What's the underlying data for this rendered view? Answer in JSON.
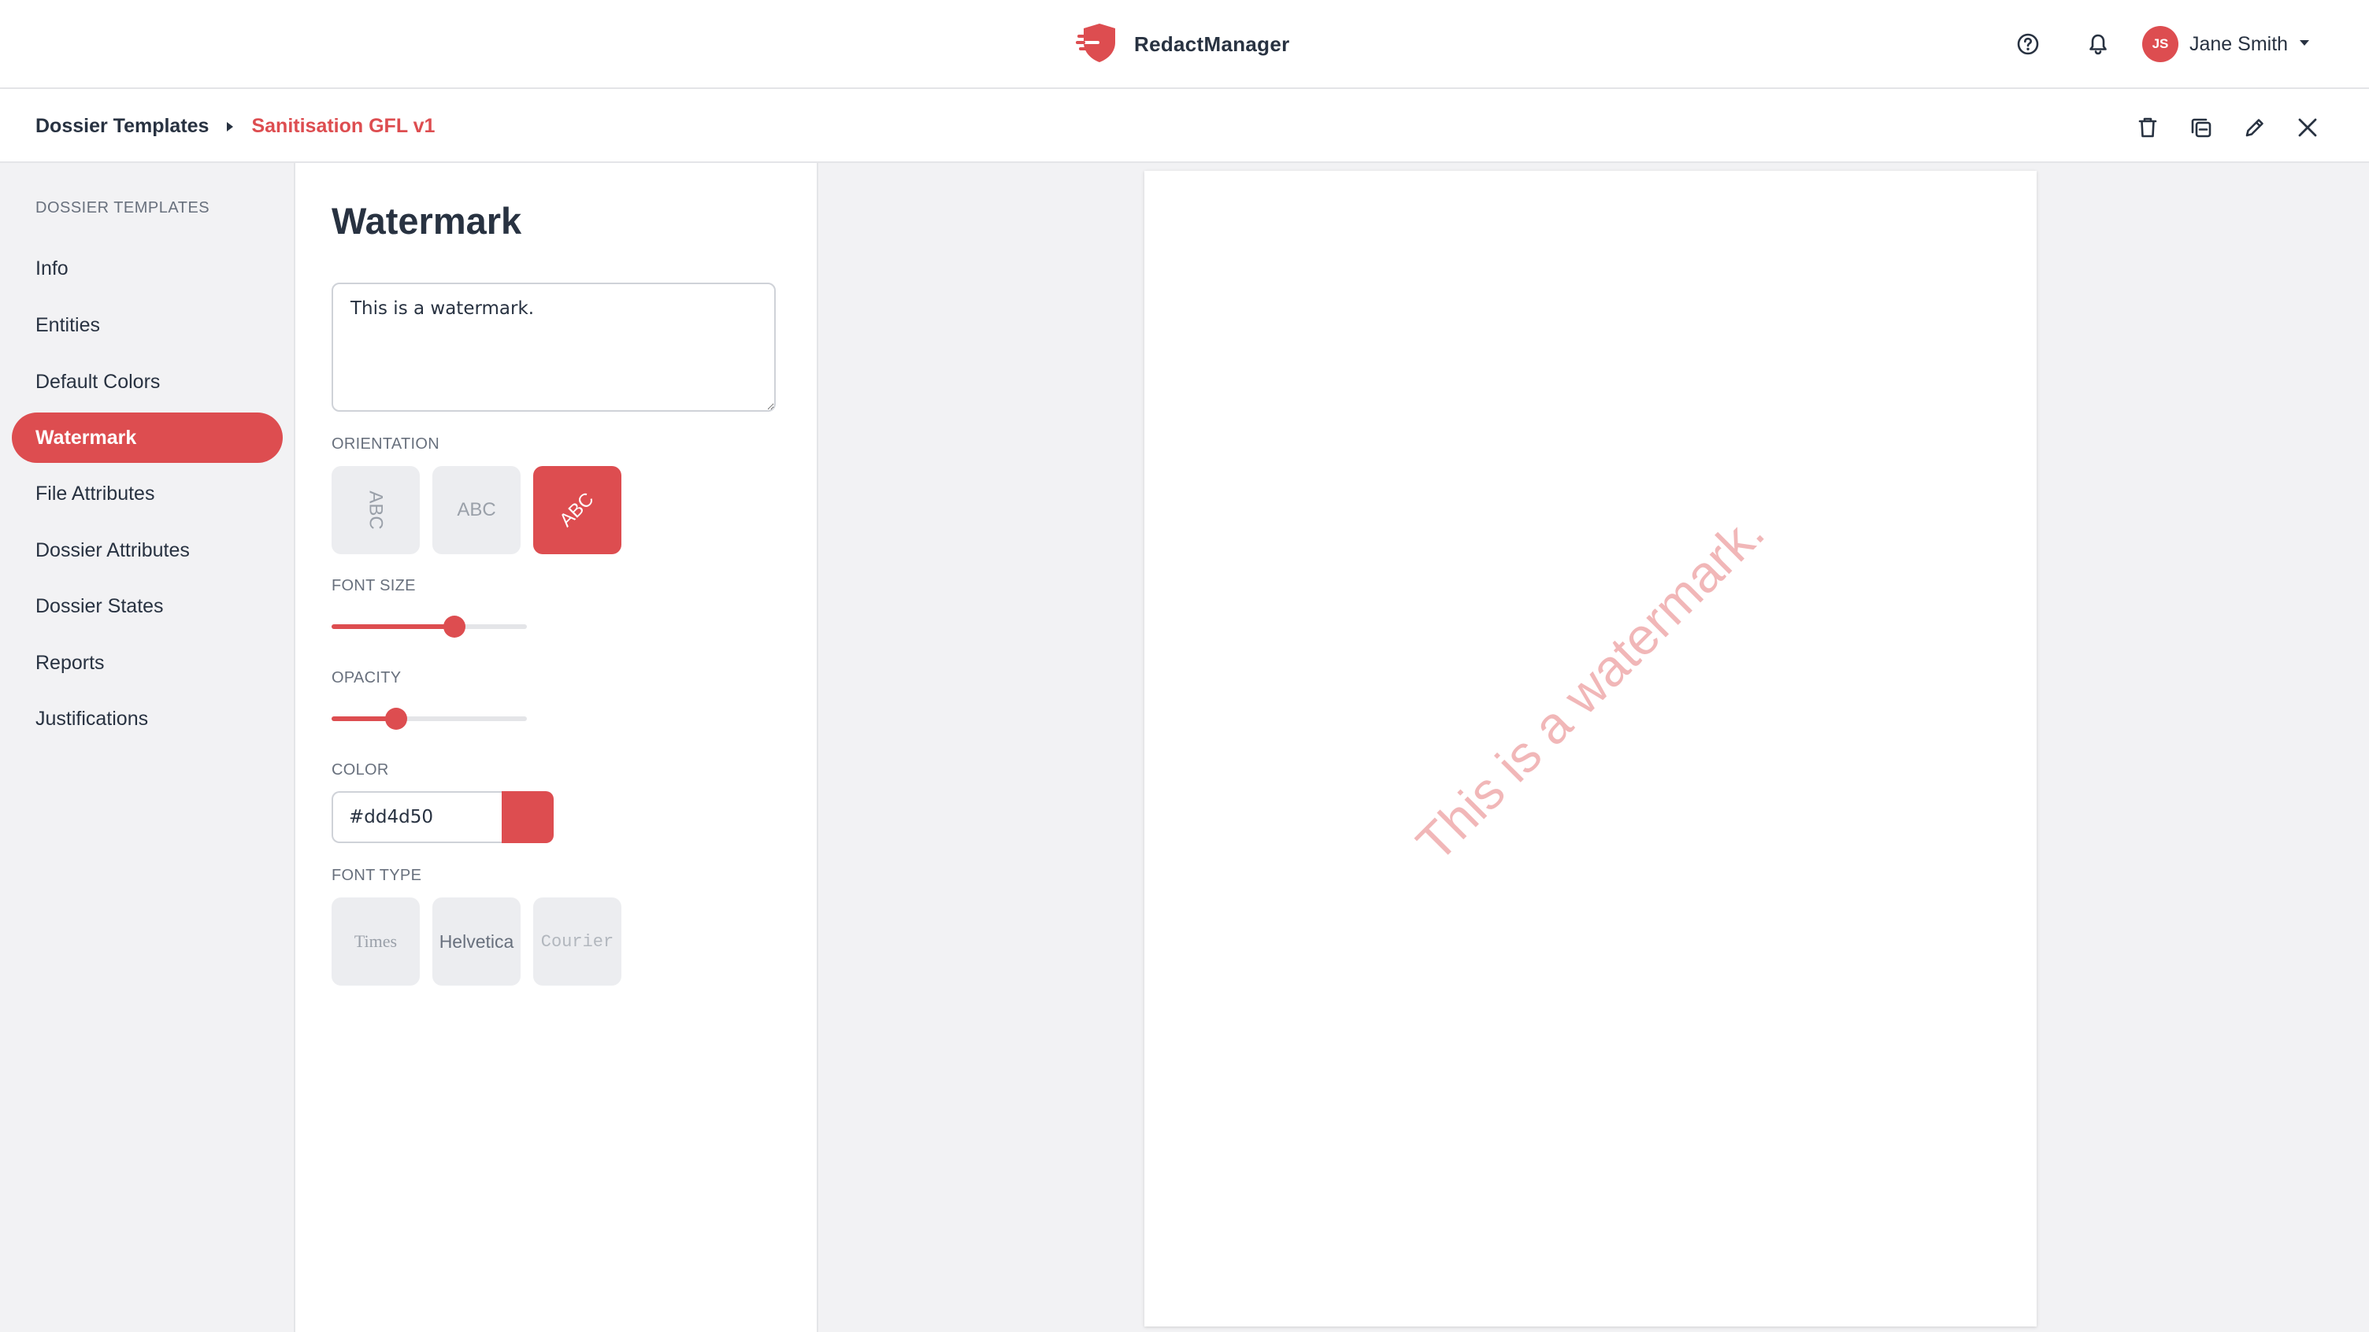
{
  "app": {
    "name": "RedactManager",
    "brand_color": "#dd4d50"
  },
  "header": {
    "help_icon": "help-circle-icon",
    "notifications_icon": "bell-icon",
    "user": {
      "initials": "JS",
      "name": "Jane Smith",
      "menu_icon": "caret-down-icon"
    }
  },
  "breadcrumb": {
    "root": "Dossier Templates",
    "separator_icon": "caret-right-icon",
    "current": "Sanitisation GFL v1"
  },
  "actions": [
    {
      "name": "delete",
      "icon": "trash-icon"
    },
    {
      "name": "clone",
      "icon": "copy-icon"
    },
    {
      "name": "edit",
      "icon": "pencil-icon"
    },
    {
      "name": "close",
      "icon": "close-icon"
    }
  ],
  "sidebar": {
    "heading": "DOSSIER TEMPLATES",
    "items": [
      {
        "label": "Info",
        "active": false
      },
      {
        "label": "Entities",
        "active": false
      },
      {
        "label": "Default Colors",
        "active": false
      },
      {
        "label": "Watermark",
        "active": true
      },
      {
        "label": "File Attributes",
        "active": false
      },
      {
        "label": "Dossier Attributes",
        "active": false
      },
      {
        "label": "Dossier States",
        "active": false
      },
      {
        "label": "Reports",
        "active": false
      },
      {
        "label": "Justifications",
        "active": false
      }
    ]
  },
  "watermark": {
    "title": "Watermark",
    "text": "This is a watermark.",
    "orientation": {
      "label": "ORIENTATION",
      "options": [
        {
          "label": "ABC",
          "value": "vertical",
          "selected": false
        },
        {
          "label": "ABC",
          "value": "horizontal",
          "selected": false
        },
        {
          "label": "ABC",
          "value": "diagonal",
          "selected": true
        }
      ]
    },
    "font_size": {
      "label": "FONT SIZE",
      "value_fraction": 0.63
    },
    "opacity": {
      "label": "OPACITY",
      "value_fraction": 0.33
    },
    "color": {
      "label": "COLOR",
      "value": "#dd4d50"
    },
    "font_type": {
      "label": "FONT TYPE",
      "options": [
        {
          "label": "Times",
          "selected": false
        },
        {
          "label": "Helvetica",
          "selected": false
        },
        {
          "label": "Courier",
          "selected": false
        }
      ]
    }
  },
  "preview": {
    "text": "This is a watermark.",
    "color": "#dd4d50",
    "opacity": 0.4
  }
}
